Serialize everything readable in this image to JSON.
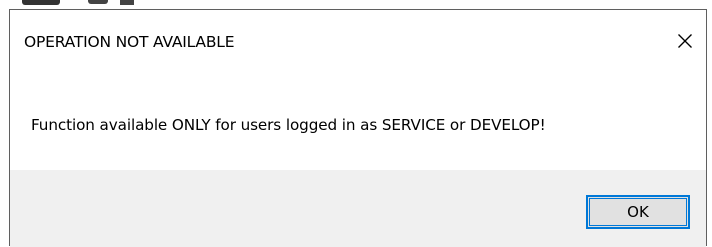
{
  "dialog": {
    "title": "OPERATION NOT AVAILABLE",
    "message": "Function available ONLY for users logged in as SERVICE or DEVELOP!",
    "ok_label": "OK",
    "close_icon": "close-icon"
  },
  "colors": {
    "accent": "#0078d7",
    "footer_bg": "#f0f0f0",
    "button_bg": "#e1e1e1"
  }
}
